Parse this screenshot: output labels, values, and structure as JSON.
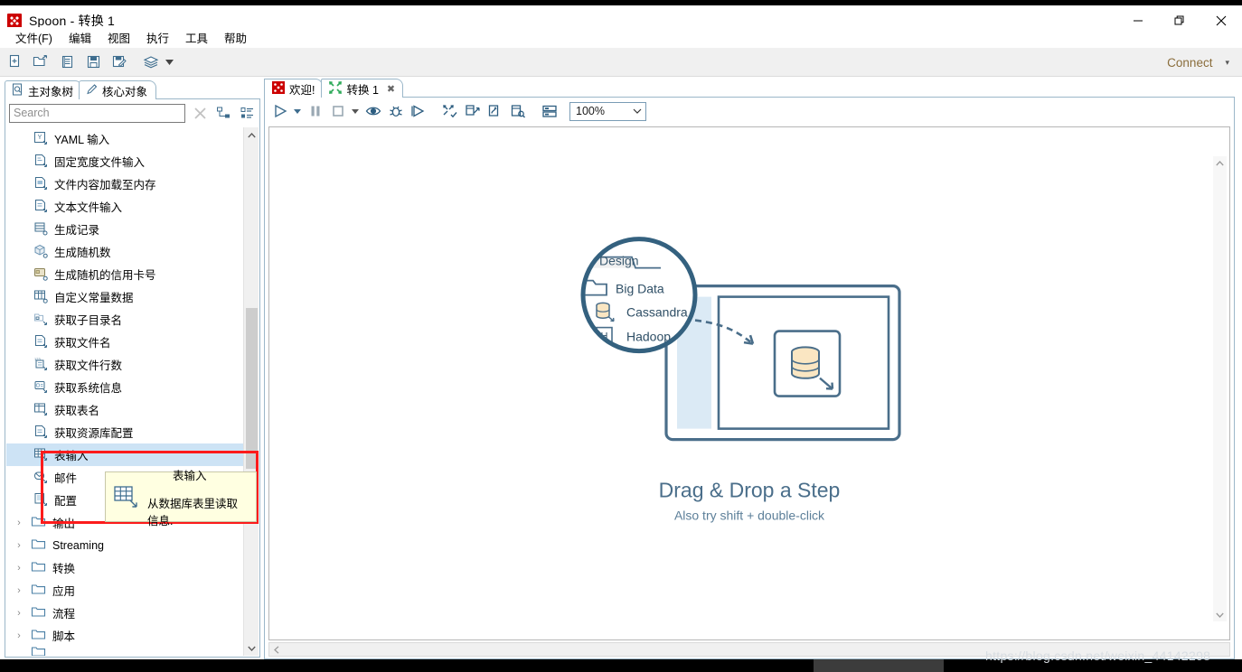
{
  "window": {
    "title": "Spoon - 转换 1",
    "app_icon": "spoon-logo-icon",
    "minimize": "—",
    "maximize": "❐",
    "close": "✕"
  },
  "menubar": {
    "items": [
      {
        "label": "文件(F)",
        "name": "menu-file"
      },
      {
        "label": "编辑",
        "name": "menu-edit"
      },
      {
        "label": "视图",
        "name": "menu-view"
      },
      {
        "label": "执行",
        "name": "menu-run"
      },
      {
        "label": "工具",
        "name": "menu-tools"
      },
      {
        "label": "帮助",
        "name": "menu-help"
      }
    ]
  },
  "toolbar": {
    "buttons": [
      {
        "name": "new-file-icon",
        "title": "新建"
      },
      {
        "name": "open-file-icon",
        "title": "打开"
      },
      {
        "name": "explore-repository-icon",
        "title": "资源库浏览"
      },
      {
        "name": "save-icon",
        "title": "保存"
      },
      {
        "name": "save-as-icon",
        "title": "另存为"
      },
      {
        "name": "layers-icon",
        "title": "图层"
      }
    ],
    "connect_label": "Connect",
    "connect_caret": "▾"
  },
  "left_panel": {
    "tabs": [
      {
        "label": "主对象树",
        "name": "tab-main-object-tree",
        "active": false,
        "icon": "document-search-icon"
      },
      {
        "label": "核心对象",
        "name": "tab-core-objects",
        "active": true,
        "icon": "pencil-icon"
      }
    ],
    "search": {
      "placeholder": "Search",
      "value": "",
      "clear_icon": "✕"
    },
    "view_icons": [
      {
        "name": "tree-view-icon"
      },
      {
        "name": "list-view-icon"
      }
    ],
    "tree_items": [
      {
        "label": "YAML 输入",
        "icon": "yaml-input-icon",
        "type": "step"
      },
      {
        "label": "固定宽度文件输入",
        "icon": "fixed-file-input-icon",
        "type": "step"
      },
      {
        "label": "文件内容加载至内存",
        "icon": "load-file-memory-icon",
        "type": "step"
      },
      {
        "label": "文本文件输入",
        "icon": "text-file-input-icon",
        "type": "step"
      },
      {
        "label": "生成记录",
        "icon": "generate-rows-icon",
        "type": "step"
      },
      {
        "label": "生成随机数",
        "icon": "generate-random-icon",
        "type": "step"
      },
      {
        "label": "生成随机的信用卡号",
        "icon": "generate-creditcard-icon",
        "type": "step"
      },
      {
        "label": "自定义常量数据",
        "icon": "custom-constant-icon",
        "type": "step"
      },
      {
        "label": "获取子目录名",
        "icon": "get-subfolder-names-icon",
        "type": "step"
      },
      {
        "label": "获取文件名",
        "icon": "get-file-names-icon",
        "type": "step"
      },
      {
        "label": "获取文件行数",
        "icon": "get-file-rowcount-icon",
        "type": "step"
      },
      {
        "label": "获取系统信息",
        "icon": "get-system-info-icon",
        "type": "step"
      },
      {
        "label": "获取表名",
        "icon": "get-table-names-icon",
        "type": "step"
      },
      {
        "label": "获取资源库配置",
        "icon": "get-repository-config-icon",
        "type": "step"
      },
      {
        "label": "表输入",
        "icon": "table-input-icon",
        "type": "step",
        "selected": true
      },
      {
        "label": "邮件",
        "icon": "mail-input-icon",
        "type": "step"
      },
      {
        "label": "配置",
        "icon": "properties-input-icon",
        "type": "step"
      }
    ],
    "folders": [
      {
        "label": "输出",
        "icon": "folder-icon",
        "arrow": "›"
      },
      {
        "label": "Streaming",
        "icon": "folder-icon",
        "arrow": "›"
      },
      {
        "label": "转换",
        "icon": "folder-icon",
        "arrow": "›"
      },
      {
        "label": "应用",
        "icon": "folder-icon",
        "arrow": "›"
      },
      {
        "label": "流程",
        "icon": "folder-icon",
        "arrow": "›"
      },
      {
        "label": "脚本",
        "icon": "folder-icon",
        "arrow": "›"
      }
    ],
    "scrollbar": {
      "up": "⌃",
      "down": "⌄"
    }
  },
  "tooltip": {
    "title": "表输入",
    "description": "从数据库表里读取信息.",
    "icon": "table-input-icon"
  },
  "right_panel": {
    "tabs": [
      {
        "label": "欢迎!",
        "name": "tab-welcome",
        "icon": "spoon-logo-icon",
        "active": false,
        "closable": false
      },
      {
        "label": "转换 1",
        "name": "tab-transformation-1",
        "icon": "transformation-icon",
        "active": true,
        "closable": true,
        "close_glyph": "✖"
      }
    ],
    "toolbar": {
      "buttons": [
        {
          "name": "run-icon"
        },
        {
          "name": "run-dropdown-caret",
          "caret": true,
          "glyph": "▾"
        },
        {
          "name": "pause-icon"
        },
        {
          "name": "stop-icon"
        },
        {
          "name": "stop-dropdown-caret",
          "caret": true,
          "glyph": "▾"
        },
        {
          "name": "preview-icon"
        },
        {
          "name": "debug-icon"
        },
        {
          "name": "replay-icon"
        },
        {
          "name": "verify-icon"
        },
        {
          "name": "analyse-impact-icon"
        },
        {
          "name": "generate-sql-icon"
        },
        {
          "name": "show-results-icon"
        },
        {
          "name": "arrange-grid-icon"
        }
      ],
      "zoom": {
        "value": "100%",
        "caret": "⌄"
      }
    },
    "canvas": {
      "illustration": {
        "magnifier": {
          "tab_label": "Design",
          "items": [
            {
              "label": "Big Data",
              "icon": "folder-icon"
            },
            {
              "label": "Cassandra",
              "icon": "cassandra-icon"
            },
            {
              "label": "Hadoop",
              "icon": "hadoop-icon",
              "badge": "H"
            }
          ]
        }
      },
      "title": "Drag & Drop a Step",
      "subtitle": "Also try shift + double-click",
      "hscroll_left": "‹",
      "vscroll_up": "⌃",
      "vscroll_down": "⌄"
    }
  },
  "watermark": "https://blog.csdn.net/weixin_44142298",
  "colors": {
    "accent": "#4a6e8a",
    "highlight_box": "#fc1b1b",
    "selection": "#cde3f5",
    "tooltip_bg": "#ffffe1",
    "connect": "#8a6d3b"
  }
}
